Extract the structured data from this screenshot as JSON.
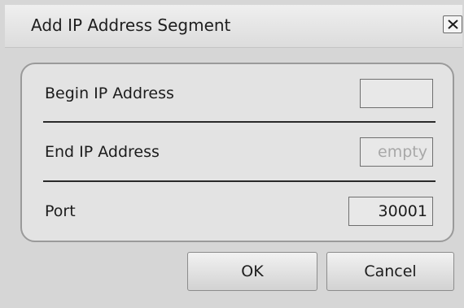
{
  "dialog": {
    "title": "Add IP Address Segment",
    "close_icon": "close-icon"
  },
  "form": {
    "begin_ip": {
      "label": "Begin IP Address",
      "value": "",
      "placeholder": ""
    },
    "end_ip": {
      "label": "End IP Address",
      "value": "",
      "placeholder": "empty"
    },
    "port": {
      "label": "Port",
      "value": "30001",
      "placeholder": ""
    }
  },
  "buttons": {
    "ok_label": "OK",
    "cancel_label": "Cancel"
  },
  "colors": {
    "dialog_background": "#d6d6d6",
    "panel_background": "#e3e3e3",
    "placeholder_text": "#a8a8a8"
  }
}
